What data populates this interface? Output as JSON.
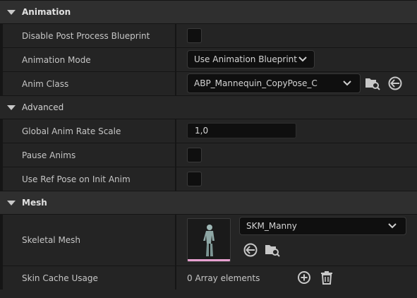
{
  "sections": {
    "animation": {
      "title": "Animation",
      "disable_post_process": {
        "label": "Disable Post Process Blueprint",
        "checked": false
      },
      "animation_mode": {
        "label": "Animation Mode",
        "value": "Use Animation Blueprint"
      },
      "anim_class": {
        "label": "Anim Class",
        "value": "ABP_Mannequin_CopyPose_C"
      }
    },
    "advanced": {
      "title": "Advanced",
      "global_anim_rate_scale": {
        "label": "Global Anim Rate Scale",
        "value": "1,0"
      },
      "pause_anims": {
        "label": "Pause Anims",
        "checked": false
      },
      "use_ref_pose": {
        "label": "Use Ref Pose on Init Anim",
        "checked": false
      }
    },
    "mesh": {
      "title": "Mesh",
      "skeletal_mesh": {
        "label": "Skeletal Mesh",
        "value": "SKM_Manny"
      },
      "skin_cache_usage": {
        "label": "Skin Cache Usage",
        "value": "0 Array elements"
      }
    }
  },
  "icons": {
    "browse": "browse-asset-icon",
    "use_selected": "use-selected-arrow-icon",
    "add": "add-element-icon",
    "delete": "trash-icon",
    "chevron": "chevron-down-icon",
    "collapse": "collapse-triangle-icon"
  },
  "colors": {
    "thumbnail_bar": "#e8a0d0",
    "panel_bg": "#242424",
    "category_bg": "#2f2f2f"
  }
}
